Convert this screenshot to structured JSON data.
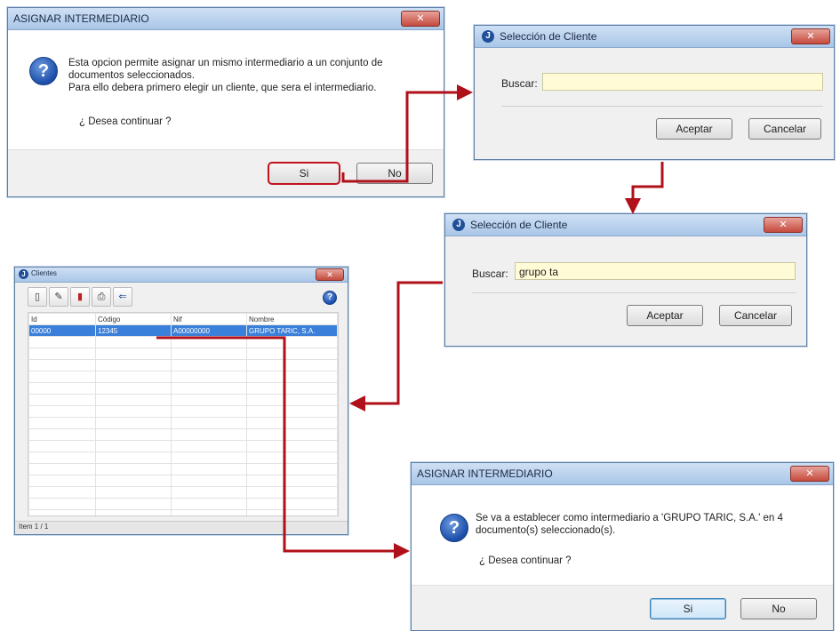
{
  "dialog1": {
    "title": "ASIGNAR INTERMEDIARIO",
    "line1": "Esta opcion permite asignar un mismo intermediario a un conjunto de",
    "line2": "documentos seleccionados.",
    "line3": "Para ello debera primero elegir un cliente, que sera el intermediario.",
    "question": "¿ Desea continuar ?",
    "yes": "Si",
    "no": "No"
  },
  "search1": {
    "title": "Selección de Cliente",
    "label": "Buscar:",
    "value": "",
    "ok": "Aceptar",
    "cancel": "Cancelar"
  },
  "search2": {
    "title": "Selección de Cliente",
    "label": "Buscar:",
    "value": "grupo ta",
    "ok": "Aceptar",
    "cancel": "Cancelar"
  },
  "clients": {
    "title": "Clientes",
    "columns": [
      "Id",
      "Código",
      "Nif",
      "Nombre"
    ],
    "selected_row": [
      "00000",
      "12345",
      "A00000000",
      "GRUPO TARIC, S.A."
    ],
    "status": "Item 1 / 1"
  },
  "dialog2": {
    "title": "ASIGNAR INTERMEDIARIO",
    "line1": "Se va a establecer como intermediario a 'GRUPO TARIC, S.A.' en 4",
    "line2": "documento(s) seleccionado(s).",
    "question": "¿ Desea continuar ?",
    "yes": "Si",
    "no": "No"
  },
  "colors": {
    "arrow": "#b0101a",
    "highlight": "#c2121c",
    "selection": "#3a7fd9"
  }
}
